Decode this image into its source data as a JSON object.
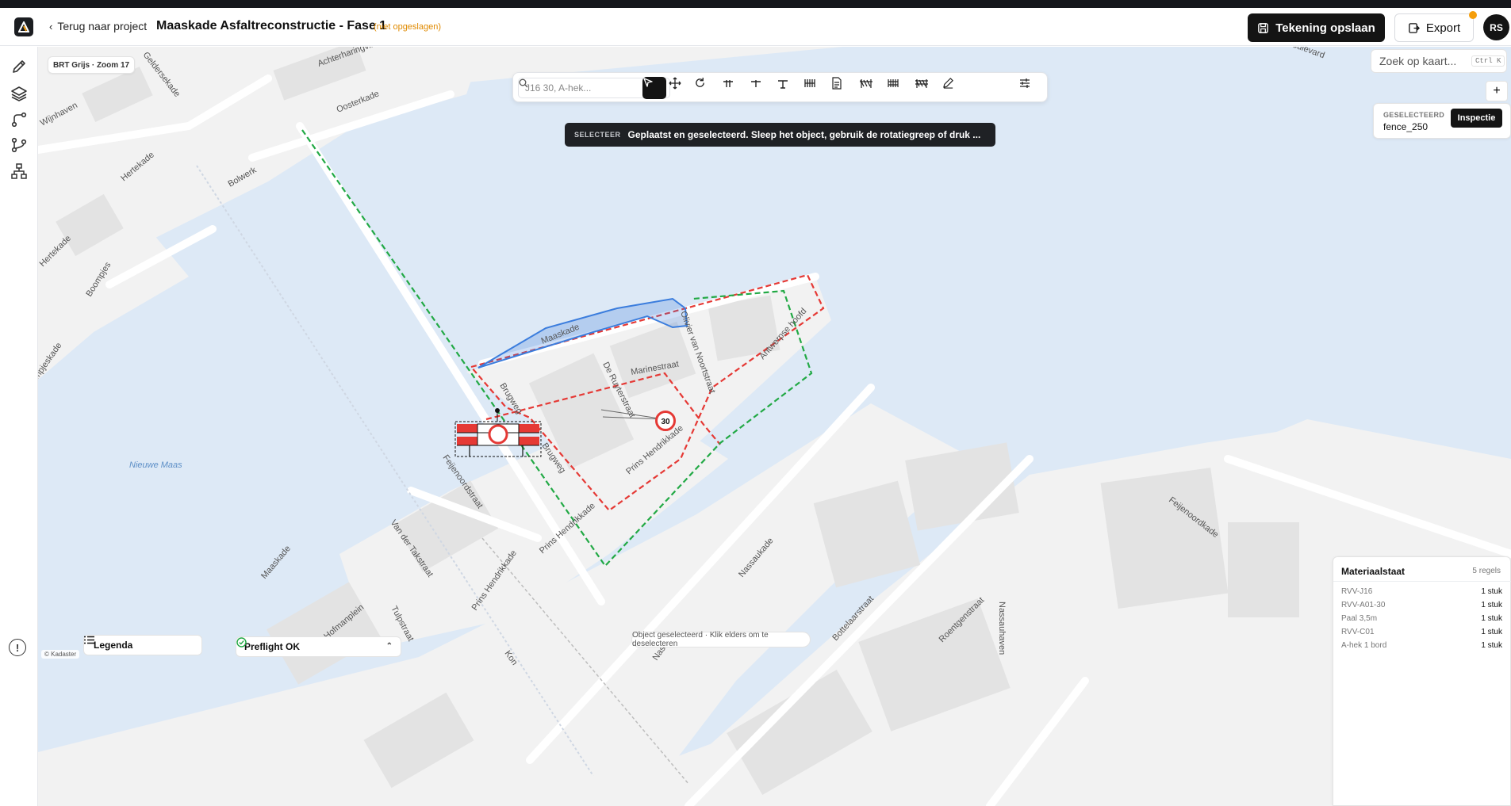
{
  "header": {
    "back_label": "Terug naar project",
    "project_title": "Maaskade Asfaltreconstructie - Fase 1",
    "unsaved_label": "(niet opgeslagen)",
    "save_label": "Tekening opslaan",
    "export_label": "Export",
    "avatar_initials": "RS"
  },
  "rail": {
    "items": [
      "pencil-icon",
      "layers-icon",
      "route-icon",
      "branch-icon",
      "hierarchy-icon"
    ],
    "help_icon": "info-icon"
  },
  "map": {
    "basemap_label": "BRT Grijs · Zoom 17",
    "search_placeholder": "Zoek op kaart...",
    "search_shortcut": "Ctrl K",
    "attribution": "© Kadaster",
    "status_hint": "Object geselecteerd · Klik elders om te deselecteren",
    "water_label": "Nieuwe Maas",
    "streets": [
      "Geldersekade",
      "Achterharingvliet",
      "Wijnhaven",
      "Oosterkade",
      "Hertekade",
      "Bolwerk",
      "Hertekade",
      "Boompjes",
      "ompjeskade",
      "Maaskade",
      "Marinestraat",
      "De Ruyterstraat",
      "Olivier van Noortstraat",
      "Antwerpse hoofd",
      "Brugweg",
      "Brugweg",
      "Feijenoordstraat",
      "Prins Hendrikkade",
      "Prins Hendrikkade",
      "Prins Hendrikkade",
      "Van der Takstraat",
      "Maaskade",
      "Hofmanplein",
      "Tulpstraat",
      "Nassaukade",
      "Bottelaarstraat",
      "Roentgenstraat",
      "Nassauhaven",
      "Feijenoordkade",
      "Nassa",
      "Kon",
      "ade",
      "sboulevard"
    ],
    "speed_sign_value": "30"
  },
  "toolbar": {
    "search_placeholder": "J16 30, A-hek...",
    "tools": [
      "select-icon",
      "move-icon",
      "rotate-icon",
      "sign-left-icon",
      "sign-center-icon",
      "sign-right-icon",
      "barrier-icon",
      "document-icon",
      "fence-icon",
      "barrier-double-icon",
      "fence-double-icon",
      "pen-icon",
      "settings-icon"
    ],
    "active_tool": "select-icon"
  },
  "banner": {
    "tag": "SELECTEER",
    "message": "Geplaatst en geselecteerd. Sleep het object, gebruik de rotatiegreep of druk ..."
  },
  "selection": {
    "label": "GESELECTEERD",
    "value": "fence_250",
    "inspect_label": "Inspectie"
  },
  "materials": {
    "title": "Materiaalstaat",
    "count_label": "5 regels",
    "rows": [
      {
        "name": "RVV-J16",
        "qty": "1 stuk"
      },
      {
        "name": "RVV-A01-30",
        "qty": "1 stuk"
      },
      {
        "name": "Paal 3,5m",
        "qty": "1 stuk"
      },
      {
        "name": "RVV-C01",
        "qty": "1 stuk"
      },
      {
        "name": "A-hek 1 bord",
        "qty": "1 stuk"
      }
    ]
  },
  "bottom": {
    "legend_label": "Legenda",
    "preflight_label": "Preflight OK"
  },
  "colors": {
    "water": "#dde9f6",
    "land": "#f2f2f2",
    "block": "#e3e3e3",
    "road": "#ffffff",
    "red_dash": "#e53935",
    "green_dash": "#22a945",
    "blue_poly": "#3b7ddd",
    "accent_orange": "#f59e0b"
  }
}
